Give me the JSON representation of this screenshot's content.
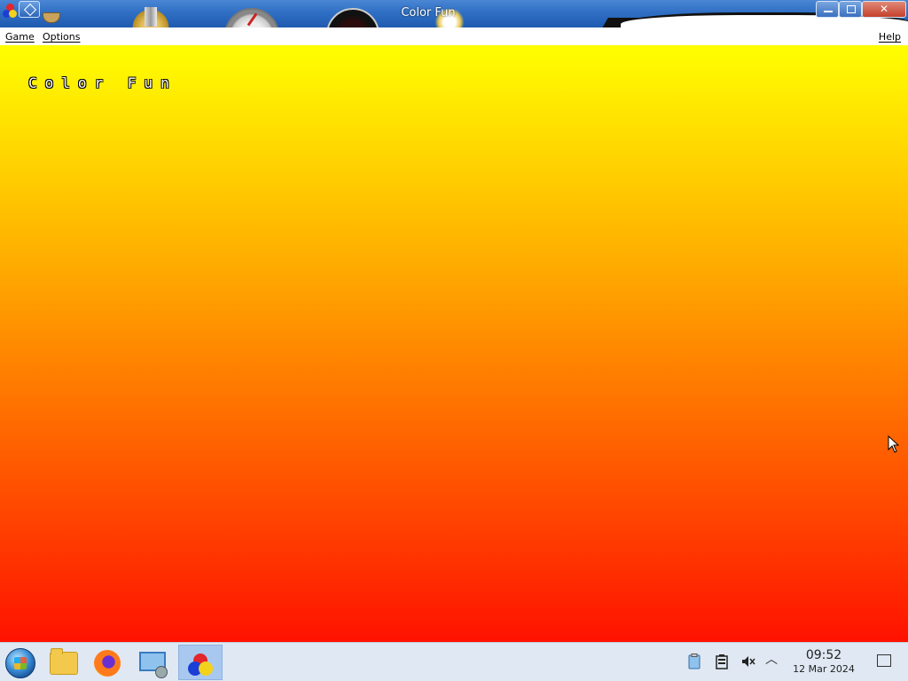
{
  "window": {
    "title": "Color Fun",
    "controls": {
      "minimize": "minimize",
      "maximize": "maximize",
      "close": "close"
    }
  },
  "menubar": {
    "game": "Game",
    "options": "Options",
    "help": "Help"
  },
  "game": {
    "title": "Color Fun",
    "gradient_colors": [
      "#ffff00",
      "#ffb000",
      "#ff5a00",
      "#ff1200"
    ]
  },
  "taskbar": {
    "apps": [
      {
        "name": "start",
        "icon": "windows-orb-icon"
      },
      {
        "name": "files",
        "icon": "folder-icon"
      },
      {
        "name": "firefox",
        "icon": "firefox-icon"
      },
      {
        "name": "control-panel",
        "icon": "control-panel-icon"
      },
      {
        "name": "color-fun",
        "icon": "color-fun-icon",
        "active": true
      }
    ],
    "tray": {
      "icons": [
        "clipboard-icon",
        "battery-icon",
        "volume-muted-icon",
        "chevron-up-icon"
      ],
      "time": "09:52",
      "date": "12 Mar 2024"
    }
  }
}
